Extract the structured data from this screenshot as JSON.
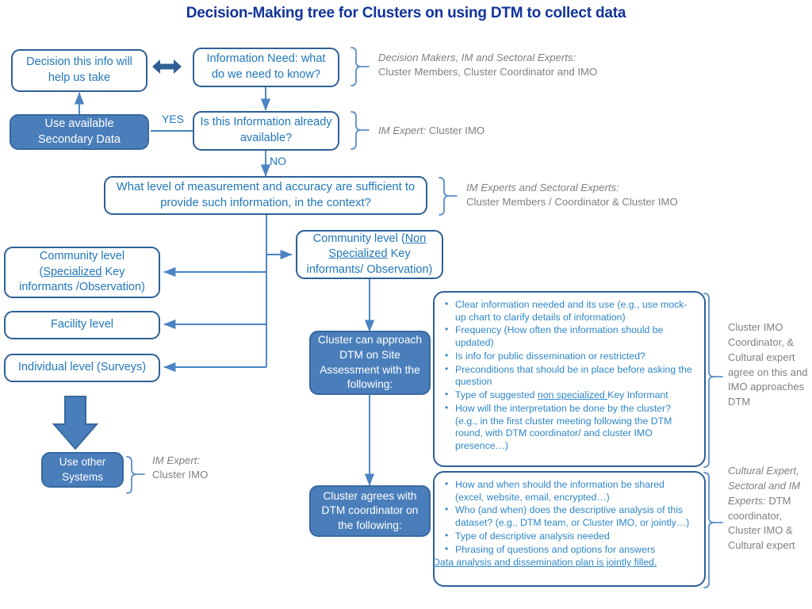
{
  "title": "Decision-Making tree for Clusters on using DTM to collect data",
  "nodes": {
    "decision_info": "Decision this info will help us take",
    "information_need": "Information Need: what do we need to know?",
    "secondary_data": "Use available Secondary Data",
    "already_available": "Is this Information already available?",
    "what_level": "What level of measurement and accuracy are sufficient to provide such information, in the context?",
    "community_specialized_l1": "Community  level",
    "community_specialized_l2_a": "(",
    "community_specialized_l2_u": "Specialized",
    "community_specialized_l2_b": " Key",
    "community_specialized_l3": "informants /Observation)",
    "community_non_l1_a": "Community  level (",
    "community_non_l1_u": "Non",
    "community_non_l2_u": "Specialized",
    "community_non_l2_b": " Key",
    "community_non_l3": "informants/ Observation)",
    "facility_level": "Facility level",
    "individual_level": "Individual level (Surveys)",
    "use_other_systems": "Use other Systems",
    "cluster_approach_dtm": "Cluster can approach DTM on Site Assessment with the following:",
    "cluster_agrees": "Cluster agrees with DTM coordinator on the following:"
  },
  "edge_labels": {
    "yes": "YES",
    "no": "NO"
  },
  "panels": {
    "site_assessment": {
      "bullets": [
        "Clear information needed and its use (e.g., use mock-up chart to clarify details of information)",
        "Frequency (How often the information should be updated)",
        "Is info for public dissemination or restricted?",
        "Preconditions that should be in place before asking the question",
        "How will the interpretation be done by the cluster? (e.g., in the first cluster meeting following the DTM round, with DTM coordinator/ and cluster IMO presence…)"
      ],
      "bullet_type_prefix": "Type of suggested ",
      "bullet_type_underlined": "non specialized ",
      "bullet_type_suffix": "Key Informant"
    },
    "agreements": {
      "bullets": [
        "How and when should the information be shared (excel, website, email, encrypted…)",
        "Who (and when) does the descriptive analysis of this dataset? (e.g., DTM team, or Cluster IMO, or jointly…)",
        "Type of descriptive analysis needed",
        "Phrasing of questions and options for answers"
      ],
      "footnote": "Data analysis and dissemination plan is jointly filled."
    }
  },
  "annotations": {
    "decision_makers": {
      "role": "Decision Makers, IM and Sectoral Experts:",
      "people": "Cluster Members, Cluster Coordinator and IMO"
    },
    "im_expert_top": {
      "role": "IM Expert:",
      "people": " Cluster IMO"
    },
    "im_sectoral": {
      "role": "IM Experts and Sectoral Experts:",
      "people": "Cluster Members / Coordinator & Cluster IMO"
    },
    "im_expert_other_systems": {
      "role": "IM Expert:",
      "people": "Cluster IMO"
    },
    "cluster_imo_agree": {
      "text": "Cluster IMO Coordinator, & Cultural expert agree on this and IMO approaches DTM"
    },
    "cultural_expert": {
      "role": "Cultural Expert, Sectoral and IM Experts:",
      "people": "DTM coordinator, Cluster IMO & Cultural expert"
    }
  },
  "colors": {
    "title": "#11339b",
    "node_border": "#2e6096",
    "node_text": "#2277bb",
    "node_fill": "#4a7ebb",
    "connector": "#4a84c4",
    "annotation_text": "#808080",
    "bracket": "#5b8fc9"
  }
}
